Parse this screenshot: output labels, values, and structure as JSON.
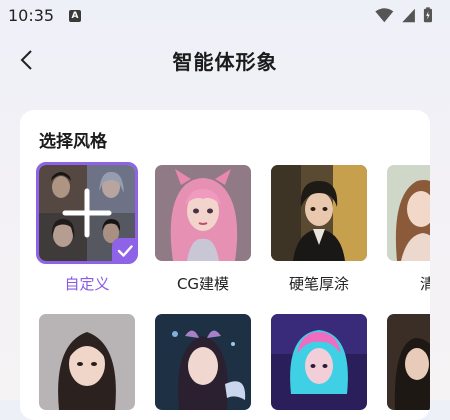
{
  "status_bar": {
    "time": "10:35",
    "badge": "A"
  },
  "header": {
    "title": "智能体形象"
  },
  "style_section": {
    "title": "选择风格",
    "row1": [
      {
        "label": "自定义",
        "selected": true
      },
      {
        "label": "CG建模",
        "selected": false
      },
      {
        "label": "硬笔厚涂",
        "selected": false
      },
      {
        "label": "清新",
        "selected": false
      }
    ]
  },
  "colors": {
    "accent": "#8e63e8",
    "accent_text": "#8a5ae4"
  }
}
